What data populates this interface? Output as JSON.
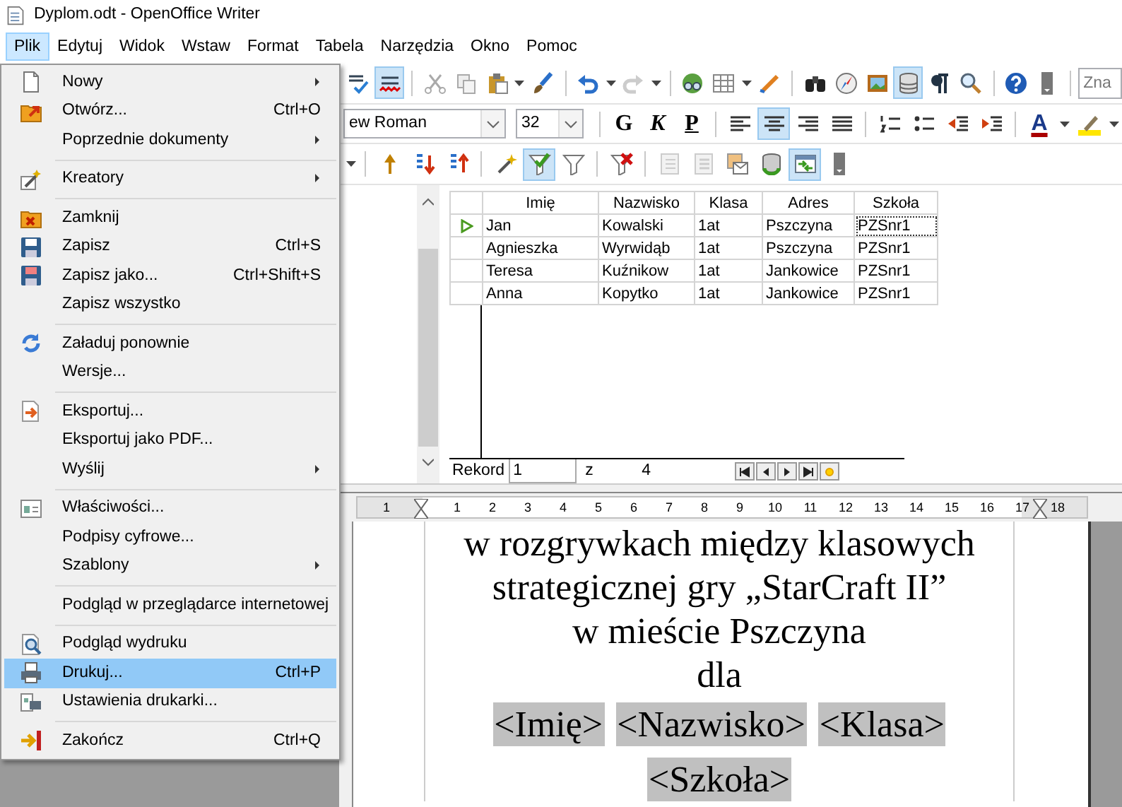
{
  "window": {
    "title": "Dyplom.odt - OpenOffice Writer"
  },
  "menubar": [
    {
      "label": "Plik",
      "selected": true
    },
    {
      "label": "Edytuj",
      "selected": false
    },
    {
      "label": "Widok",
      "selected": false
    },
    {
      "label": "Wstaw",
      "selected": false
    },
    {
      "label": "Format",
      "selected": false
    },
    {
      "label": "Tabela",
      "selected": false
    },
    {
      "label": "Narzędzia",
      "selected": false
    },
    {
      "label": "Okno",
      "selected": false
    },
    {
      "label": "Pomoc",
      "selected": false
    }
  ],
  "toolbar_standard": [
    {
      "kind": "spell",
      "pressed": false
    },
    {
      "kind": "autospell",
      "pressed": true
    },
    {
      "kind": "separator"
    },
    {
      "kind": "cut",
      "pressed": false
    },
    {
      "kind": "copy",
      "pressed": false
    },
    {
      "kind": "paste",
      "pressed": false
    },
    {
      "kind": "dropdown"
    },
    {
      "kind": "brush",
      "pressed": false
    },
    {
      "kind": "separator"
    },
    {
      "kind": "undo",
      "pressed": false
    },
    {
      "kind": "dropdown"
    },
    {
      "kind": "redo",
      "pressed": false
    },
    {
      "kind": "dropdown"
    },
    {
      "kind": "separator"
    },
    {
      "kind": "globe",
      "pressed": false
    },
    {
      "kind": "table",
      "pressed": false
    },
    {
      "kind": "dropdown"
    },
    {
      "kind": "pencil",
      "pressed": false
    },
    {
      "kind": "separator"
    },
    {
      "kind": "binoculars",
      "pressed": false
    },
    {
      "kind": "compass",
      "pressed": false
    },
    {
      "kind": "picture",
      "pressed": false
    },
    {
      "kind": "database",
      "pressed": true
    },
    {
      "kind": "pilcrow",
      "pressed": false
    },
    {
      "kind": "zoom",
      "pressed": false
    },
    {
      "kind": "separator"
    },
    {
      "kind": "help",
      "pressed": false
    },
    {
      "kind": "overflow",
      "pressed": false
    },
    {
      "kind": "separator"
    },
    {
      "kind": "search",
      "placeholder": "Zna"
    }
  ],
  "toolbar_formatting": [
    {
      "kind": "combo",
      "value": "ew Roman"
    },
    {
      "kind": "combo",
      "value": "32"
    },
    {
      "kind": "separator"
    },
    {
      "kind": "bold",
      "label": "G",
      "pressed": false
    },
    {
      "kind": "italic",
      "label": "K",
      "pressed": false
    },
    {
      "kind": "underline",
      "label": "P",
      "pressed": false
    },
    {
      "kind": "separator"
    },
    {
      "kind": "alignleft",
      "pressed": false
    },
    {
      "kind": "aligncenter",
      "pressed": true
    },
    {
      "kind": "alignright",
      "pressed": false
    },
    {
      "kind": "justify",
      "pressed": false
    },
    {
      "kind": "separator"
    },
    {
      "kind": "numbering",
      "pressed": false
    },
    {
      "kind": "bullets",
      "pressed": false
    },
    {
      "kind": "outdent",
      "pressed": false
    },
    {
      "kind": "indent",
      "pressed": false
    },
    {
      "kind": "separator"
    },
    {
      "kind": "fontcolor",
      "label": "A",
      "pressed": false
    },
    {
      "kind": "dropdown"
    },
    {
      "kind": "highlight",
      "pressed": false
    },
    {
      "kind": "dropdown"
    }
  ],
  "toolbar_data": [
    {
      "kind": "dropdown"
    },
    {
      "kind": "separator"
    },
    {
      "kind": "sortup",
      "pressed": false
    },
    {
      "kind": "sortasc",
      "pressed": false
    },
    {
      "kind": "sortdesc",
      "pressed": false
    },
    {
      "kind": "separator"
    },
    {
      "kind": "wand",
      "pressed": false
    },
    {
      "kind": "filtercheck",
      "pressed": true
    },
    {
      "kind": "filter",
      "pressed": false
    },
    {
      "kind": "separator"
    },
    {
      "kind": "filterremove",
      "pressed": false
    },
    {
      "kind": "separator"
    },
    {
      "kind": "datatext",
      "pressed": false
    },
    {
      "kind": "datafields",
      "pressed": false
    },
    {
      "kind": "mailmerge",
      "pressed": false
    },
    {
      "kind": "dbrefresh",
      "pressed": false
    },
    {
      "kind": "explorer",
      "pressed": true
    },
    {
      "kind": "overflow",
      "pressed": false
    }
  ],
  "data_grid": {
    "columns": [
      "Imię",
      "Nazwisko",
      "Klasa",
      "Adres",
      "Szkoła"
    ],
    "rows": [
      {
        "selected": true,
        "cells": [
          "Jan",
          "Kowalski",
          "1at",
          "Pszczyna",
          "PZSnr1"
        ]
      },
      {
        "selected": false,
        "cells": [
          "Agnieszka",
          "Wyrwidąb",
          "1at",
          "Pszczyna",
          "PZSnr1"
        ]
      },
      {
        "selected": false,
        "cells": [
          "Teresa",
          "Kuźnikow",
          "1at",
          "Jankowice",
          "PZSnr1"
        ]
      },
      {
        "selected": false,
        "cells": [
          "Anna",
          "Kopytko",
          "1at",
          "Jankowice",
          "PZSnr1"
        ]
      }
    ]
  },
  "record_bar": {
    "label": "Rekord",
    "current": "1",
    "of": "z",
    "total": "4"
  },
  "ruler": {
    "left_labels": [
      "1"
    ],
    "labels": [
      "1",
      "2",
      "3",
      "4",
      "5",
      "6",
      "7",
      "8",
      "9",
      "10",
      "11",
      "12",
      "13",
      "14",
      "15",
      "16",
      "17",
      "18"
    ]
  },
  "document": {
    "lines": [
      "w rozgrywkach między klasowych",
      "strategicznej gry „StarCraft II”",
      "w mieście Pszczyna",
      "dla"
    ],
    "field_rows": [
      [
        "<Imię>",
        "<Nazwisko>",
        "<Klasa>"
      ],
      [
        "<Szkoła>"
      ]
    ]
  },
  "file_menu": [
    {
      "kind": "new",
      "label": "Nowy",
      "submenu": true,
      "selected": false
    },
    {
      "kind": "open",
      "label": "Otwórz...",
      "shortcut": "Ctrl+O",
      "submenu": false,
      "selected": false
    },
    {
      "kind": "plain",
      "label": "Poprzednie dokumenty",
      "submenu": true,
      "selected": false
    },
    {
      "kind": "separator"
    },
    {
      "kind": "wizard",
      "label": "Kreatory",
      "submenu": true,
      "selected": false
    },
    {
      "kind": "separator"
    },
    {
      "kind": "close",
      "label": "Zamknij",
      "submenu": false,
      "selected": false
    },
    {
      "kind": "save",
      "label": "Zapisz",
      "shortcut": "Ctrl+S",
      "submenu": false,
      "selected": false
    },
    {
      "kind": "saveas",
      "label": "Zapisz jako...",
      "shortcut": "Ctrl+Shift+S",
      "submenu": false,
      "selected": false
    },
    {
      "kind": "plain",
      "label": "Zapisz wszystko",
      "submenu": false,
      "selected": false
    },
    {
      "kind": "separator"
    },
    {
      "kind": "reload",
      "label": "Załaduj ponownie",
      "submenu": false,
      "selected": false
    },
    {
      "kind": "plain",
      "label": "Wersje...",
      "submenu": false,
      "selected": false
    },
    {
      "kind": "separator"
    },
    {
      "kind": "export",
      "label": "Eksportuj...",
      "submenu": false,
      "selected": false
    },
    {
      "kind": "plain",
      "label": "Eksportuj jako PDF...",
      "submenu": false,
      "selected": false
    },
    {
      "kind": "plain",
      "label": "Wyślij",
      "submenu": true,
      "selected": false
    },
    {
      "kind": "separator"
    },
    {
      "kind": "properties",
      "label": "Właściwości...",
      "submenu": false,
      "selected": false
    },
    {
      "kind": "plain",
      "label": "Podpisy cyfrowe...",
      "submenu": false,
      "selected": false
    },
    {
      "kind": "plain",
      "label": "Szablony",
      "submenu": true,
      "selected": false
    },
    {
      "kind": "separator"
    },
    {
      "kind": "plain",
      "label": "Podgląd w przeglądarce internetowej",
      "submenu": false,
      "selected": false
    },
    {
      "kind": "separator"
    },
    {
      "kind": "preview",
      "label": "Podgląd wydruku",
      "submenu": false,
      "selected": false
    },
    {
      "kind": "print",
      "label": "Drukuj...",
      "shortcut": "Ctrl+P",
      "submenu": false,
      "selected": true
    },
    {
      "kind": "printersettings",
      "label": "Ustawienia drukarki...",
      "submenu": false,
      "selected": false
    },
    {
      "kind": "separator"
    },
    {
      "kind": "exit",
      "label": "Zakończ",
      "shortcut": "Ctrl+Q",
      "submenu": false,
      "selected": false
    }
  ]
}
